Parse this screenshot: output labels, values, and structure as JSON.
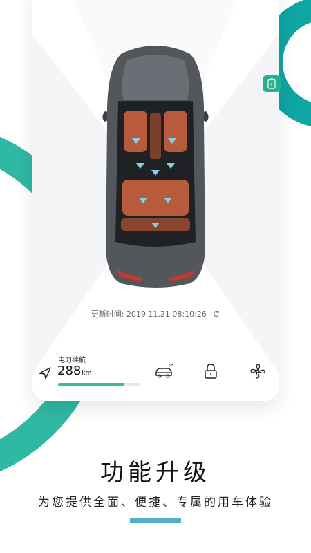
{
  "colors": {
    "teal_ring": "#0ea5a3",
    "teal_stripe": "#2fb8a4",
    "accent_bar": "#4fb0c6",
    "range_fill": "#33c089",
    "battery_tag": "#22b38c",
    "interior": "#b85a3c",
    "car_body": "#53575c"
  },
  "card": {
    "update_time_label": "更新时间: 2019.11.21 08:10:26",
    "range_label": "电力续航",
    "range_value": "288",
    "range_unit": "km",
    "range_fill_fraction": 0.8,
    "icons": [
      "navigation-arrow-icon",
      "remote-car-icon",
      "lock-icon",
      "fan-icon",
      "refresh-icon",
      "battery-charging-icon"
    ]
  },
  "promo": {
    "title": "功能升级",
    "subtitle": "为您提供全面、便捷、专属的用车体验"
  }
}
